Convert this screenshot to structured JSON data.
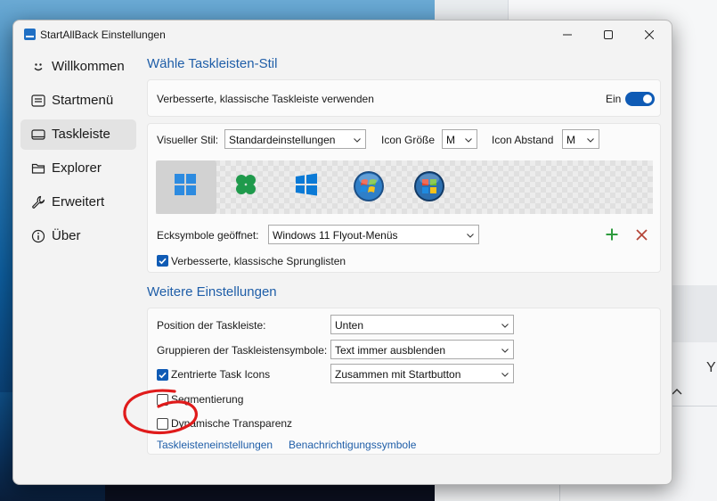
{
  "window": {
    "title": "StartAllBack Einstellungen"
  },
  "sidebar": {
    "items": [
      {
        "label": "Willkommen",
        "icon": "smile-icon"
      },
      {
        "label": "Startmenü",
        "icon": "start-menu-icon"
      },
      {
        "label": "Taskleiste",
        "icon": "taskbar-icon",
        "active": true
      },
      {
        "label": "Explorer",
        "icon": "folder-icon"
      },
      {
        "label": "Erweitert",
        "icon": "wrench-icon"
      },
      {
        "label": "Über",
        "icon": "info-icon"
      }
    ]
  },
  "main": {
    "section1_title": "Wähle Taskleisten-Stil",
    "enhanced_taskbar": {
      "label": "Verbesserte, klassische Taskleiste verwenden",
      "toggle_label": "Ein",
      "on": true
    },
    "visual_style": {
      "label": "Visueller Stil:",
      "value": "Standardeinstellungen"
    },
    "icon_size": {
      "label": "Icon Größe",
      "value": "M"
    },
    "icon_spacing": {
      "label": "Icon Abstand",
      "value": "M"
    },
    "style_tiles": [
      "windows-11-logo-icon",
      "clover-logo-icon",
      "windows-10-logo-icon",
      "windows-7-orb-icon",
      "windows-vista-orb-icon"
    ],
    "corner_symbols": {
      "label": "Ecksymbole geöffnet:",
      "value": "Windows 11 Flyout-Menüs"
    },
    "jumplists": {
      "label": "Verbesserte, klassische Sprunglisten",
      "checked": true
    },
    "section2_title": "Weitere Einstellungen",
    "taskbar_position": {
      "label": "Position der Taskleiste:",
      "value": "Unten"
    },
    "grouping": {
      "label": "Gruppieren der Taskleistensymbole:",
      "value": "Text immer ausblenden"
    },
    "centered_icons": {
      "label": "Zentrierte Task Icons",
      "checked": true,
      "value": "Zusammen mit Startbutton"
    },
    "segmentation": {
      "label": "Segmentierung",
      "checked": false
    },
    "dynamic_transparency": {
      "label": "Dynamische Transparenz",
      "checked": false
    },
    "links": {
      "taskbar_settings": "Taskleisteneinstellungen",
      "notification_icons": "Benachrichtigungssymbole"
    }
  },
  "background": {
    "partial_text": "Y"
  },
  "colors": {
    "accent": "#0f5bb5",
    "section_title": "#1f5ea8",
    "add_green": "#2e9b3e",
    "remove_red": "#b5473a",
    "annotation_red": "#e01b1b"
  }
}
